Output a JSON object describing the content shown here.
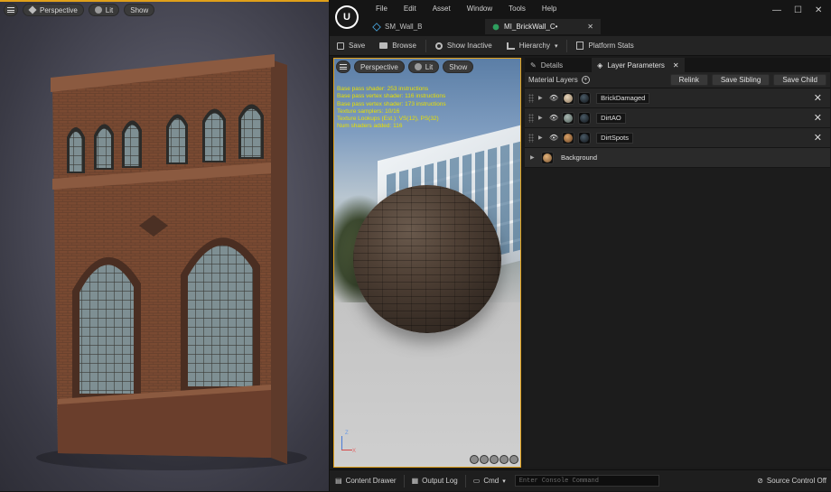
{
  "viewport": {
    "mode_label": "Perspective",
    "lit_label": "Lit",
    "show_label": "Show"
  },
  "editor": {
    "menu": [
      "File",
      "Edit",
      "Asset",
      "Window",
      "Tools",
      "Help"
    ],
    "tabs": [
      {
        "label": "SM_Wall_B"
      },
      {
        "label": "MI_BrickWall_C•"
      }
    ],
    "toolbar": {
      "save_label": "Save",
      "browse_label": "Browse",
      "show_inactive_label": "Show Inactive",
      "hierarchy_label": "Hierarchy",
      "platform_stats_label": "Platform Stats"
    },
    "preview": {
      "mode_label": "Perspective",
      "lit_label": "Lit",
      "show_label": "Show",
      "stats": [
        "Base pass shader: 253 instructions",
        "Base pass vertex shader: 116 instructions",
        "Base pass vertex shader: 173 instructions",
        "Texture samplers: 10/16",
        "Texture Lookups (Est.): VS(12), PS(32)",
        "Num shaders added: 116"
      ],
      "axis_z": "Z",
      "axis_x": "X"
    },
    "panel": {
      "details_tab": "Details",
      "layer_params_tab": "Layer Parameters",
      "layers_title": "Material Layers",
      "relink_label": "Relink",
      "save_sibling_label": "Save Sibling",
      "save_child_label": "Save Child",
      "layers": [
        {
          "name": "BrickDamaged"
        },
        {
          "name": "DirtAO"
        },
        {
          "name": "DirtSpots"
        }
      ],
      "background_label": "Background"
    },
    "statusbar": {
      "content_drawer_label": "Content Drawer",
      "output_log_label": "Output Log",
      "cmd_label": "Cmd",
      "console_placeholder": "Enter Console Command",
      "source_control_label": "Source Control Off"
    }
  }
}
